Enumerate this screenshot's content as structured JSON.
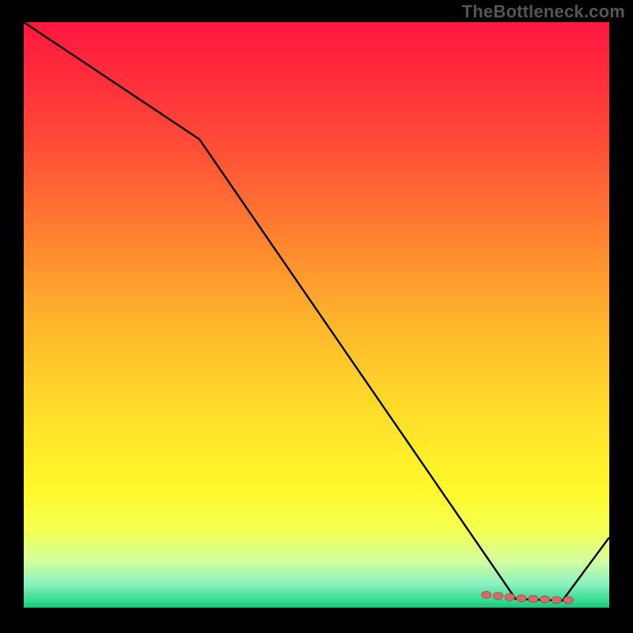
{
  "watermark": "TheBottleneck.com",
  "colors": {
    "page_bg": "#000000",
    "line": "#000000",
    "marker_fill": "#d26b6b",
    "marker_stroke": "#b14c4c",
    "gradient_top": "#ff173f",
    "gradient_bottom": "#18c478",
    "watermark": "#555555"
  },
  "chart_data": {
    "type": "line",
    "title": "",
    "xlabel": "",
    "ylabel": "",
    "xlim": [
      0,
      100
    ],
    "ylim": [
      0,
      100
    ],
    "grid": false,
    "legend": false,
    "series": [
      {
        "name": "curve",
        "x": [
          0,
          30,
          84,
          92,
          100
        ],
        "values": [
          100,
          80,
          1.5,
          1.2,
          12
        ]
      }
    ],
    "markers": {
      "name": "optimum-band",
      "x": [
        79,
        81,
        83,
        85,
        87,
        89,
        91,
        93
      ],
      "values": [
        2.2,
        2.0,
        1.8,
        1.6,
        1.5,
        1.4,
        1.3,
        1.3
      ]
    }
  }
}
